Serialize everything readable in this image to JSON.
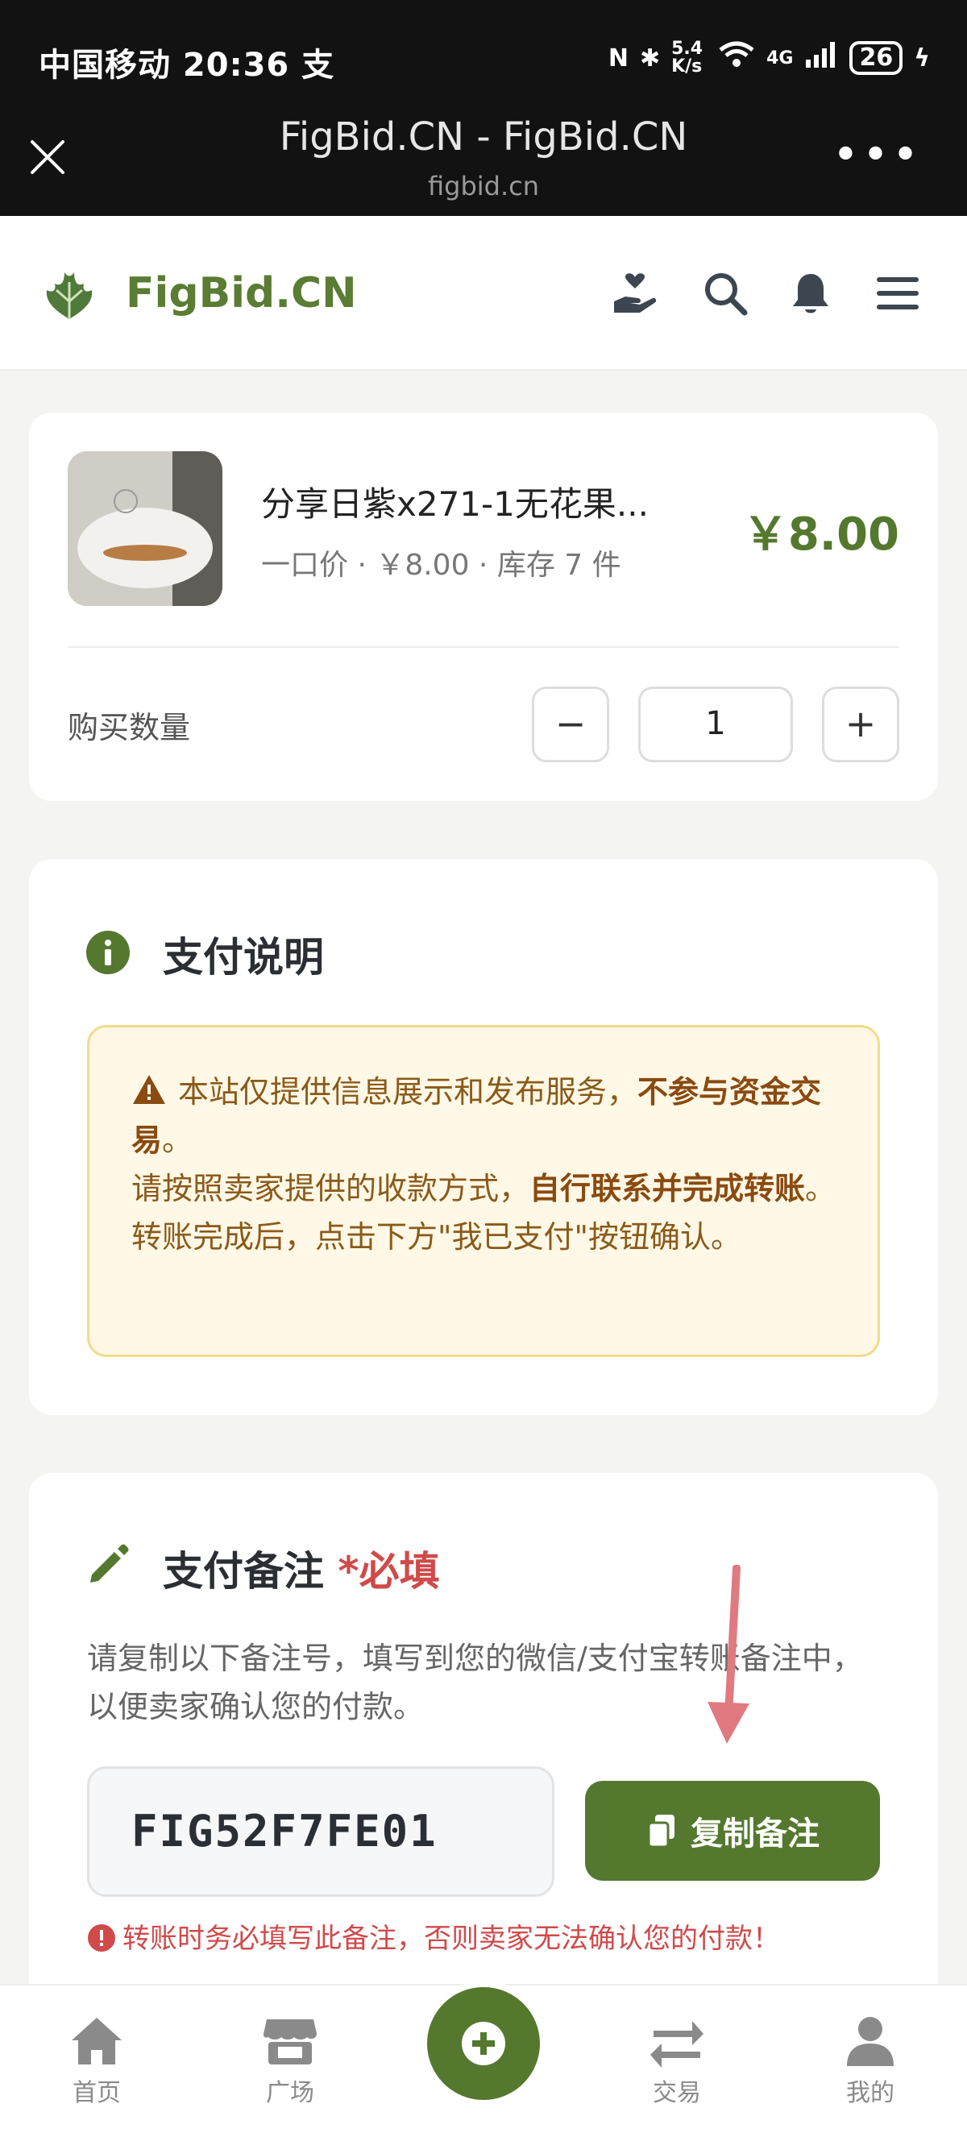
{
  "status_bar": {
    "left_text": "中国移动 20:36 支",
    "net_speed": "5.4 K/s",
    "net_type": "4G",
    "battery": "26"
  },
  "browser": {
    "title": "FigBid.CN - FigBid.CN",
    "domain": "figbid.cn"
  },
  "site": {
    "name": "FigBid.CN"
  },
  "product": {
    "title": "分享日紫x271-1无花果...",
    "subtitle": "一口价 · ￥8.00 · 库存 7 件",
    "price": "￥8.00",
    "quantity_label": "购买数量",
    "quantity": "1",
    "minus": "−",
    "plus": "+"
  },
  "payment_info": {
    "title": "支付说明",
    "line1_normal": "本站仅提供信息展示和发布服务，",
    "line1_bold": "不参与资金交易",
    "line1_end": "。",
    "line2_normal": "请按照卖家提供的收款方式，",
    "line2_bold": "自行联系并完成转账",
    "line2_end": "。转账完成后，点击下方\"我已支付\"按钮确认。"
  },
  "payment_memo": {
    "title": "支付备注",
    "required": "*必填",
    "description": "请复制以下备注号，填写到您的微信/支付宝转账备注中，以便卖家确认您的付款。",
    "code": "FIG52F7FE01",
    "copy_button": "复制备注",
    "warning": "转账时务必填写此备注，否则卖家无法确认您的付款！"
  },
  "bottom_nav": {
    "home": "首页",
    "plaza": "广场",
    "trade": "交易",
    "mine": "我的"
  },
  "colors": {
    "brand": "#55782f",
    "required": "#d04a4a",
    "notice_bg": "#fff8e6",
    "annotation_arrow": "#e07a80"
  }
}
